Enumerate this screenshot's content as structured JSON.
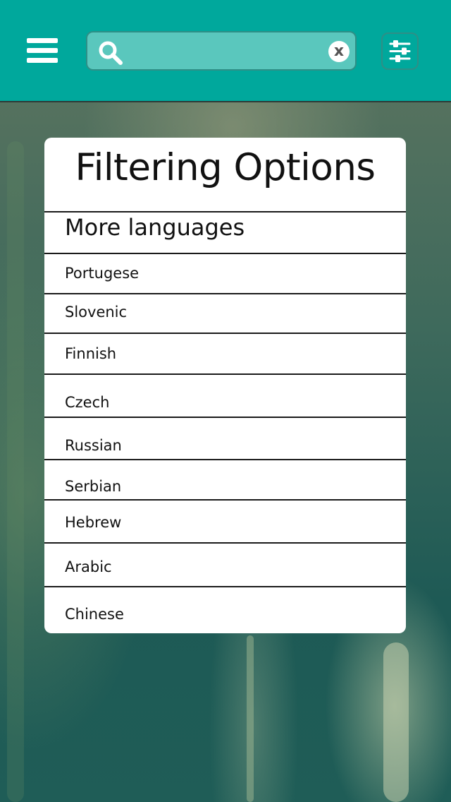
{
  "header": {
    "menu_icon": "hamburger-menu-icon",
    "search": {
      "value": "",
      "placeholder": "",
      "search_icon": "magnifier-icon",
      "clear_icon": "clear-x-icon",
      "clear_glyph": "x"
    },
    "filter_icon": "sliders-icon",
    "color": "#00a89c"
  },
  "panel": {
    "title": "Filtering Options",
    "section_header": "More languages",
    "languages": [
      "Portugese",
      "Slovenic",
      "Finnish",
      "Czech",
      "Russian",
      "Serbian",
      "Hebrew",
      "Arabic",
      "Chinese"
    ]
  }
}
